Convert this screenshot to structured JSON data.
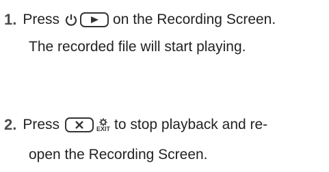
{
  "steps": [
    {
      "number": "1.",
      "line1_before": "Press",
      "line1_after": "on the Recording Screen.",
      "line2": "The recorded file will start playing.",
      "icons": [
        "power-icon",
        "play-icon"
      ]
    },
    {
      "number": "2.",
      "line1_before": "Press",
      "line1_after": "to stop playback and re-",
      "line2": "open the Recording Screen.",
      "exit_label": "EXIT",
      "icons": [
        "close-icon",
        "gear-icon"
      ]
    }
  ],
  "colors": {
    "text": "#222222",
    "number": "#4a4a4a",
    "icon_stroke": "#333333"
  }
}
